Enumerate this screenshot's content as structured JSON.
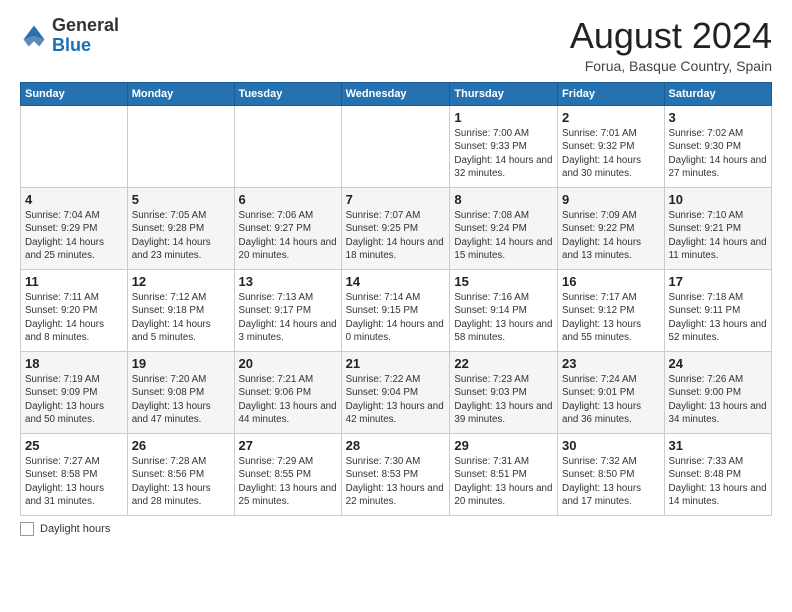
{
  "logo": {
    "general": "General",
    "blue": "Blue"
  },
  "title": "August 2024",
  "subtitle": "Forua, Basque Country, Spain",
  "days_of_week": [
    "Sunday",
    "Monday",
    "Tuesday",
    "Wednesday",
    "Thursday",
    "Friday",
    "Saturday"
  ],
  "legend": {
    "label": "Daylight hours"
  },
  "weeks": [
    [
      {
        "day": "",
        "info": ""
      },
      {
        "day": "",
        "info": ""
      },
      {
        "day": "",
        "info": ""
      },
      {
        "day": "",
        "info": ""
      },
      {
        "day": "1",
        "info": "Sunrise: 7:00 AM\nSunset: 9:33 PM\nDaylight: 14 hours and 32 minutes."
      },
      {
        "day": "2",
        "info": "Sunrise: 7:01 AM\nSunset: 9:32 PM\nDaylight: 14 hours and 30 minutes."
      },
      {
        "day": "3",
        "info": "Sunrise: 7:02 AM\nSunset: 9:30 PM\nDaylight: 14 hours and 27 minutes."
      }
    ],
    [
      {
        "day": "4",
        "info": "Sunrise: 7:04 AM\nSunset: 9:29 PM\nDaylight: 14 hours and 25 minutes."
      },
      {
        "day": "5",
        "info": "Sunrise: 7:05 AM\nSunset: 9:28 PM\nDaylight: 14 hours and 23 minutes."
      },
      {
        "day": "6",
        "info": "Sunrise: 7:06 AM\nSunset: 9:27 PM\nDaylight: 14 hours and 20 minutes."
      },
      {
        "day": "7",
        "info": "Sunrise: 7:07 AM\nSunset: 9:25 PM\nDaylight: 14 hours and 18 minutes."
      },
      {
        "day": "8",
        "info": "Sunrise: 7:08 AM\nSunset: 9:24 PM\nDaylight: 14 hours and 15 minutes."
      },
      {
        "day": "9",
        "info": "Sunrise: 7:09 AM\nSunset: 9:22 PM\nDaylight: 14 hours and 13 minutes."
      },
      {
        "day": "10",
        "info": "Sunrise: 7:10 AM\nSunset: 9:21 PM\nDaylight: 14 hours and 11 minutes."
      }
    ],
    [
      {
        "day": "11",
        "info": "Sunrise: 7:11 AM\nSunset: 9:20 PM\nDaylight: 14 hours and 8 minutes."
      },
      {
        "day": "12",
        "info": "Sunrise: 7:12 AM\nSunset: 9:18 PM\nDaylight: 14 hours and 5 minutes."
      },
      {
        "day": "13",
        "info": "Sunrise: 7:13 AM\nSunset: 9:17 PM\nDaylight: 14 hours and 3 minutes."
      },
      {
        "day": "14",
        "info": "Sunrise: 7:14 AM\nSunset: 9:15 PM\nDaylight: 14 hours and 0 minutes."
      },
      {
        "day": "15",
        "info": "Sunrise: 7:16 AM\nSunset: 9:14 PM\nDaylight: 13 hours and 58 minutes."
      },
      {
        "day": "16",
        "info": "Sunrise: 7:17 AM\nSunset: 9:12 PM\nDaylight: 13 hours and 55 minutes."
      },
      {
        "day": "17",
        "info": "Sunrise: 7:18 AM\nSunset: 9:11 PM\nDaylight: 13 hours and 52 minutes."
      }
    ],
    [
      {
        "day": "18",
        "info": "Sunrise: 7:19 AM\nSunset: 9:09 PM\nDaylight: 13 hours and 50 minutes."
      },
      {
        "day": "19",
        "info": "Sunrise: 7:20 AM\nSunset: 9:08 PM\nDaylight: 13 hours and 47 minutes."
      },
      {
        "day": "20",
        "info": "Sunrise: 7:21 AM\nSunset: 9:06 PM\nDaylight: 13 hours and 44 minutes."
      },
      {
        "day": "21",
        "info": "Sunrise: 7:22 AM\nSunset: 9:04 PM\nDaylight: 13 hours and 42 minutes."
      },
      {
        "day": "22",
        "info": "Sunrise: 7:23 AM\nSunset: 9:03 PM\nDaylight: 13 hours and 39 minutes."
      },
      {
        "day": "23",
        "info": "Sunrise: 7:24 AM\nSunset: 9:01 PM\nDaylight: 13 hours and 36 minutes."
      },
      {
        "day": "24",
        "info": "Sunrise: 7:26 AM\nSunset: 9:00 PM\nDaylight: 13 hours and 34 minutes."
      }
    ],
    [
      {
        "day": "25",
        "info": "Sunrise: 7:27 AM\nSunset: 8:58 PM\nDaylight: 13 hours and 31 minutes."
      },
      {
        "day": "26",
        "info": "Sunrise: 7:28 AM\nSunset: 8:56 PM\nDaylight: 13 hours and 28 minutes."
      },
      {
        "day": "27",
        "info": "Sunrise: 7:29 AM\nSunset: 8:55 PM\nDaylight: 13 hours and 25 minutes."
      },
      {
        "day": "28",
        "info": "Sunrise: 7:30 AM\nSunset: 8:53 PM\nDaylight: 13 hours and 22 minutes."
      },
      {
        "day": "29",
        "info": "Sunrise: 7:31 AM\nSunset: 8:51 PM\nDaylight: 13 hours and 20 minutes."
      },
      {
        "day": "30",
        "info": "Sunrise: 7:32 AM\nSunset: 8:50 PM\nDaylight: 13 hours and 17 minutes."
      },
      {
        "day": "31",
        "info": "Sunrise: 7:33 AM\nSunset: 8:48 PM\nDaylight: 13 hours and 14 minutes."
      }
    ]
  ]
}
